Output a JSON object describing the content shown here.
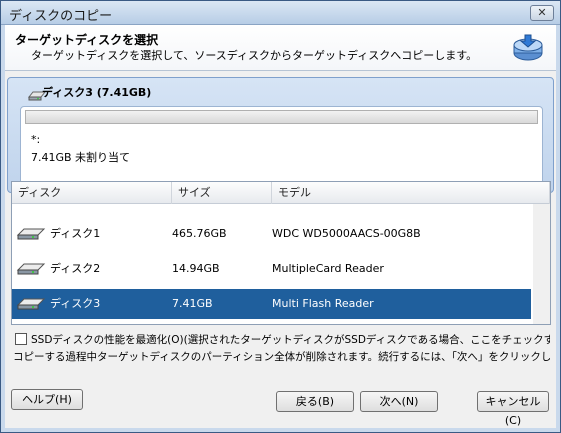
{
  "window": {
    "title": "ディスクのコピー",
    "close_glyph": "✕"
  },
  "header": {
    "title": "ターゲットディスクを選択",
    "subtitle": "ターゲットディスクを選択して、ソースディスクからターゲットディスクへコピーします。"
  },
  "disk_panel": {
    "title": "ディスク3 (7.41GB)",
    "partition_name": "*:",
    "partition_desc": "7.41GB 未割り当て"
  },
  "list": {
    "columns": [
      "ディスク",
      "サイズ",
      "モデル"
    ],
    "rows": [
      {
        "disk": "ディスク1",
        "size": "465.76GB",
        "model": "WDC WD5000AACS-00G8B"
      },
      {
        "disk": "ディスク2",
        "size": "14.94GB",
        "model": "MultipleCard  Reader"
      },
      {
        "disk": "ディスク3",
        "size": "7.41GB",
        "model": "Multi   Flash Reader"
      }
    ],
    "selected_index": 2
  },
  "ssd_option": {
    "checked": false,
    "label": "SSDディスクの性能を最適化(O)(選択されたターゲットディスクがSSDディスクである場合、ここをチェックすることを!"
  },
  "info": "コピーする過程中ターゲットディスクのパーティション全体が削除されます。続行するには、「次へ」をクリックしてくださ",
  "buttons": {
    "help": "ヘルプ(H)",
    "back": "戻る(B)",
    "next": "次へ(N)",
    "cancel": "キャンセル(C)"
  },
  "colors": {
    "selection": "#1f5f9d",
    "panel": "#c9d9ec"
  }
}
